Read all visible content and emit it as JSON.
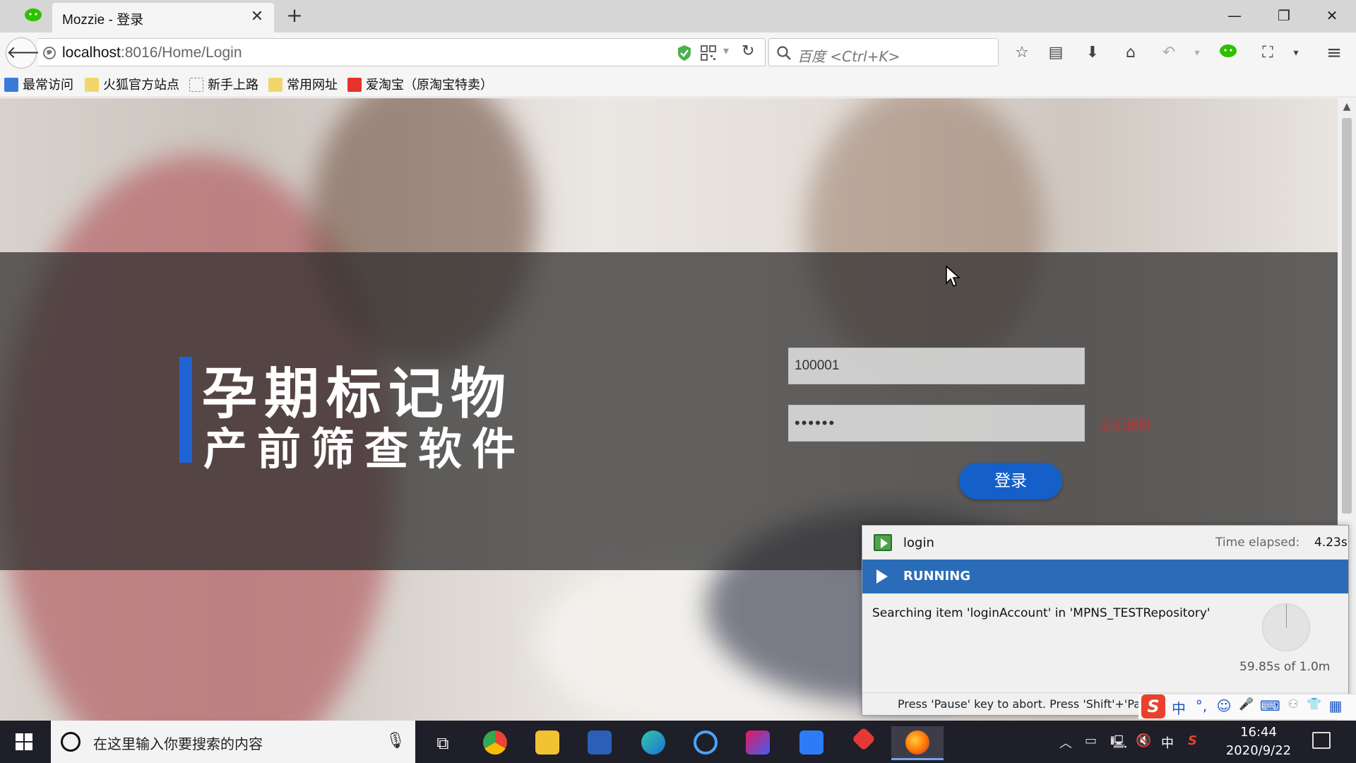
{
  "browser": {
    "tab_title": "Mozzie - 登录",
    "tab_close": "✕",
    "new_tab": "+",
    "window_minimize": "—",
    "window_restore": "❐",
    "window_close": "✕",
    "url_host": "localhost",
    "url_rest": ":8016/Home/Login",
    "search_placeholder": "百度 <Ctrl+K>",
    "bookmarks": [
      "最常访问",
      "火狐官方站点",
      "新手上路",
      "常用网址",
      "爱淘宝（原淘宝特卖）"
    ]
  },
  "page": {
    "title_line1": "孕期标记物",
    "title_line2": "产前筛查软件",
    "account_value": "100001",
    "password_masked": "••••••",
    "forgot_link": "忘记密码",
    "login_button": "登录",
    "accent_color": "#1f63d4"
  },
  "runner": {
    "name": "login",
    "elapsed_label": "Time elapsed:",
    "elapsed_value": "4.23s",
    "status": "RUNNING",
    "message": "Searching item 'loginAccount' in 'MPNS_TESTRepository'",
    "progress_text": "59.85s of 1.0m",
    "footer": "Press 'Pause' key to abort. Press 'Shift'+'Pause'"
  },
  "ime": {
    "logo": "S",
    "items": [
      "中",
      "°,",
      "☺",
      "🎤",
      "⌨",
      "👕",
      "▦"
    ]
  },
  "taskbar": {
    "search_placeholder": "在这里输入你要搜索的内容",
    "time": "16:44",
    "date": "2020/9/22",
    "lang": "中"
  }
}
